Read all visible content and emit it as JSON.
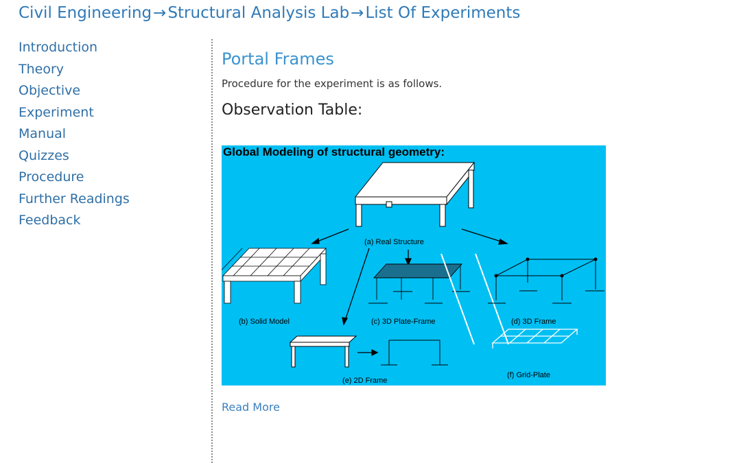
{
  "breadcrumb": {
    "items": [
      "Civil Engineering",
      "Structural Analysis Lab",
      "List Of Experiments"
    ],
    "separator": "→"
  },
  "sidebar": {
    "items": [
      {
        "label": "Introduction"
      },
      {
        "label": "Theory"
      },
      {
        "label": "Objective"
      },
      {
        "label": "Experiment"
      },
      {
        "label": "Manual"
      },
      {
        "label": "Quizzes"
      },
      {
        "label": "Procedure"
      },
      {
        "label": "Further Readings"
      },
      {
        "label": "Feedback"
      }
    ]
  },
  "main": {
    "title": "Portal Frames",
    "description": "Procedure for the experiment is as follows.",
    "section_heading": "Observation Table:",
    "figure": {
      "heading": "Global Modeling of structural geometry:",
      "labels": {
        "a": "(a) Real Structure",
        "b": "(b) Solid Model",
        "c": "(c) 3D Plate-Frame",
        "d": "(d) 3D Frame",
        "e": "(e) 2D Frame",
        "f": "(f) Grid-Plate"
      },
      "background_color": "#00bff3"
    },
    "read_more": "Read More"
  },
  "colors": {
    "link": "#2f7ab8",
    "title": "#3a93cf"
  }
}
